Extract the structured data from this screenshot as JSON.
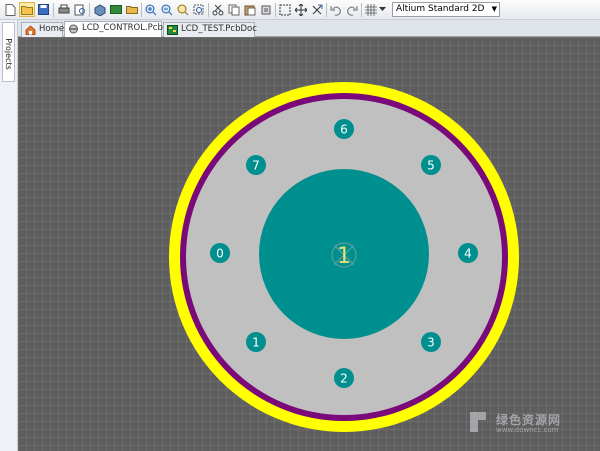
{
  "toolbar": {
    "view_mode": "Altium Standard 2D"
  },
  "side_panel": {
    "projects_tab": "Projects"
  },
  "tabs": [
    {
      "label": "Home",
      "icon": "home-icon"
    },
    {
      "label": "LCD_CONTROL.PcbLib",
      "icon": "pcblib-icon",
      "active": true
    },
    {
      "label": "LCD_TEST.PcbDoc",
      "icon": "pcbdoc-icon"
    }
  ],
  "footprint": {
    "center_pad_label": "1",
    "pads": [
      "6",
      "5",
      "4",
      "3",
      "2",
      "1",
      "0",
      "7"
    ]
  },
  "watermark": {
    "line1": "绿色资源网",
    "line2": "www.downcc.com"
  },
  "colors": {
    "canvas_bg": "#5e5e5e",
    "silkscreen_outer": "#ffff00",
    "keepout_ring": "#7a0a7a",
    "board_fill": "#c0c0c0",
    "pad_teal": "#008f8f",
    "pad_label": "#ffffff",
    "center_label": "#e8e070"
  }
}
